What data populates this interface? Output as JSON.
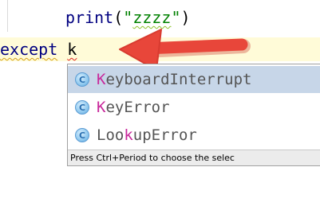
{
  "editor": {
    "line1": {
      "func": "print",
      "open": "(",
      "string_quote_open": "\"",
      "string_content": "zzzz",
      "string_quote_close": "\"",
      "close": ")"
    },
    "line2": {
      "keyword": "except",
      "space": " ",
      "identifier": "k"
    }
  },
  "completion": {
    "items": [
      {
        "icon": "class-icon",
        "icon_letter": "C",
        "match": "K",
        "rest": "eyboardInterrupt",
        "selected": true
      },
      {
        "icon": "class-icon",
        "icon_letter": "C",
        "match": "K",
        "rest": "eyError",
        "selected": false
      },
      {
        "icon": "class-icon",
        "icon_letter": "C",
        "prefix": "Loo",
        "match": "k",
        "rest": "upError",
        "selected": false
      }
    ],
    "footer": "Press Ctrl+Period to choose the selec"
  },
  "colors": {
    "annotation_arrow": "#e8463a",
    "selected_row": "#c7d6e8",
    "current_line": "#fffbd8",
    "match_highlight": "#c8289b"
  }
}
